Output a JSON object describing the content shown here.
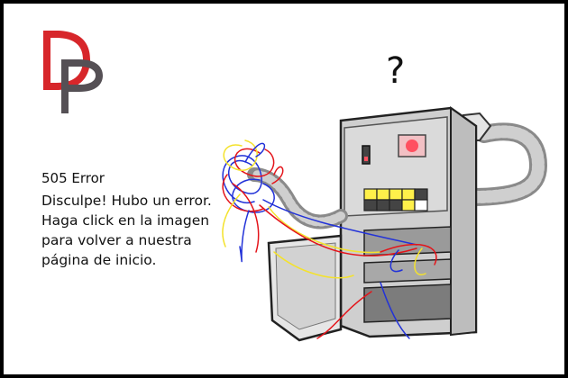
{
  "logo": {
    "letters": "DP",
    "colors": {
      "d": "#d7262a",
      "p": "#555055"
    }
  },
  "error": {
    "title": "505 Error",
    "message": "Disculpe! Hubo un error. Haga click en la imagen para volver a nuestra página de inicio."
  },
  "illustration": {
    "question_mark": "?",
    "icon": "broken-computer-illustration"
  },
  "colors": {
    "frame": "#000000",
    "indicator_red": "#ff5060",
    "panel_yellow": "#fff04a",
    "wire_red": "#e4141a",
    "wire_blue": "#2232d8",
    "wire_yellow": "#f4e22c"
  }
}
